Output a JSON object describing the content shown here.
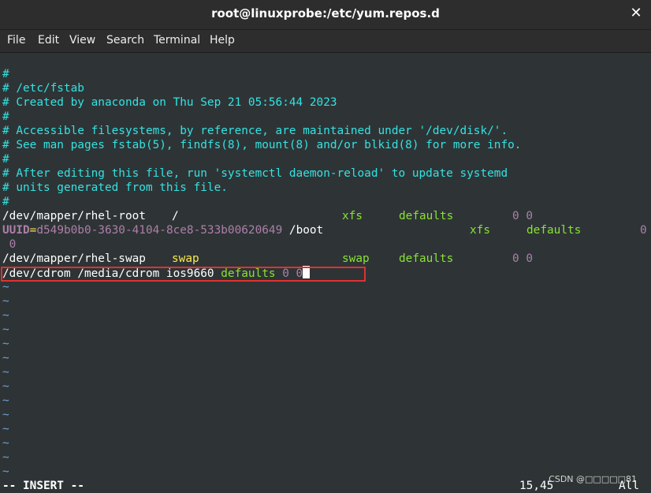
{
  "window": {
    "title": "root@linuxprobe:/etc/yum.repos.d",
    "close_glyph": "✕"
  },
  "menu": [
    "File",
    "Edit",
    "View",
    "Search",
    "Terminal",
    "Help"
  ],
  "file_lines": {
    "l1": "#",
    "l2": "# /etc/fstab",
    "l3": "# Created by anaconda on Thu Sep 21 05:56:44 2023",
    "l4": "#",
    "l5": "# Accessible filesystems, by reference, are maintained under '/dev/disk/'.",
    "l6": "# See man pages fstab(5), findfs(8), mount(8) and/or blkid(8) for more info.",
    "l7": "#",
    "l8": "# After editing this file, run 'systemctl daemon-reload' to update systemd",
    "l9": "# units generated from this file.",
    "l10": "#",
    "root_dev": "/dev/mapper/rhel-root",
    "root_mount": "/",
    "root_fs": "xfs",
    "root_opts": "defaults",
    "root_nums": "0 0",
    "uuid_key": "UUID",
    "uuid_eq": "=",
    "uuid_val": "d549b0b0-3630-4104-8ce8-533b00620649",
    "uuid_mount": "/boot",
    "uuid_fs": "xfs",
    "uuid_opts": "defaults",
    "uuid_num1": "0",
    "uuid_num2": "0",
    "swap_dev": "/dev/mapper/rhel-swap",
    "swap_mount": "swap",
    "swap_fs": "swap",
    "swap_opts": "defaults",
    "swap_nums": "0 0",
    "cdrom_line": "/dev/cdrom /media/cdrom ios9660 ",
    "cdrom_opts": "defaults",
    "cdrom_nums": " 0 0"
  },
  "tilde": "~",
  "status": {
    "mode": "-- INSERT --",
    "position": "15,45",
    "scroll": "All"
  },
  "watermark": "CSDN @□□□□□81",
  "colors": {
    "background": "#2e3436",
    "comment": "#34e2e2",
    "keyword_green": "#8ae234",
    "swap_yellow": "#fce94f",
    "number_magenta": "#ad7fa8",
    "tilde_blue": "#729fcf",
    "highlight_box": "#e03131"
  }
}
